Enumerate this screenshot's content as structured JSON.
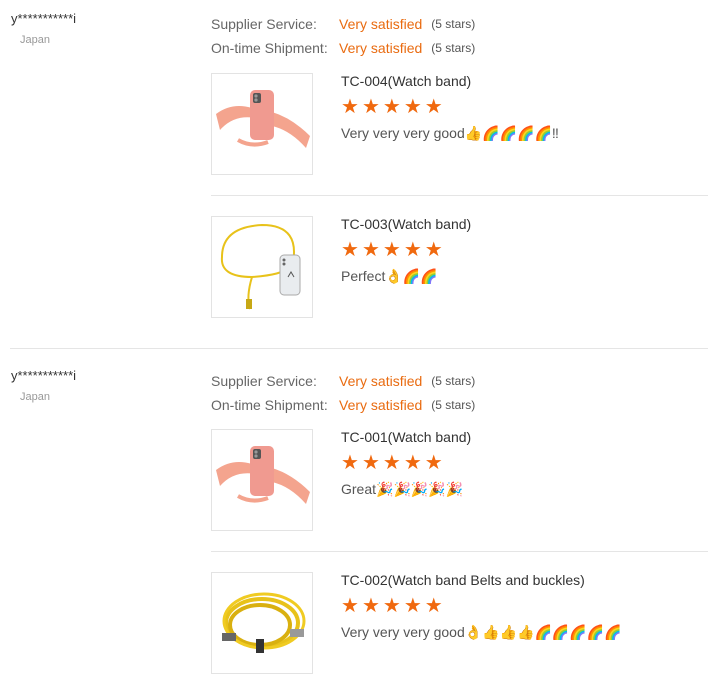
{
  "reviews": [
    {
      "reviewer": "y***********i",
      "country": "Japan",
      "ratings": [
        {
          "label": "Supplier Service:",
          "value": "Very satisfied",
          "stars_text": "(5 stars)"
        },
        {
          "label": "On-time Shipment:",
          "value": "Very satisfied",
          "stars_text": "(5 stars)"
        }
      ],
      "products": [
        {
          "title": "TC-004(Watch band)",
          "stars": 5,
          "comment": "Very very very good👍🌈🌈🌈🌈‼",
          "image": "pink-phone-case-strap"
        },
        {
          "title": "TC-003(Watch band)",
          "stars": 5,
          "comment": "Perfect👌🌈🌈",
          "image": "yellow-lanyard-clear-case"
        }
      ]
    },
    {
      "reviewer": "y***********i",
      "country": "Japan",
      "ratings": [
        {
          "label": "Supplier Service:",
          "value": "Very satisfied",
          "stars_text": "(5 stars)"
        },
        {
          "label": "On-time Shipment:",
          "value": "Very satisfied",
          "stars_text": "(5 stars)"
        }
      ],
      "products": [
        {
          "title": "TC-001(Watch band)",
          "stars": 5,
          "comment": "Great🎉🎉🎉🎉🎉",
          "image": "pink-phone-case-strap"
        },
        {
          "title": "TC-002(Watch band Belts and buckles)",
          "stars": 5,
          "comment": "Very very very good👌👍👍👍🌈🌈🌈🌈🌈",
          "image": "yellow-coiled-cable"
        }
      ]
    }
  ],
  "colors": {
    "accent": "#e96b10",
    "star": "#f0690f",
    "divider": "#e5e5e5"
  }
}
